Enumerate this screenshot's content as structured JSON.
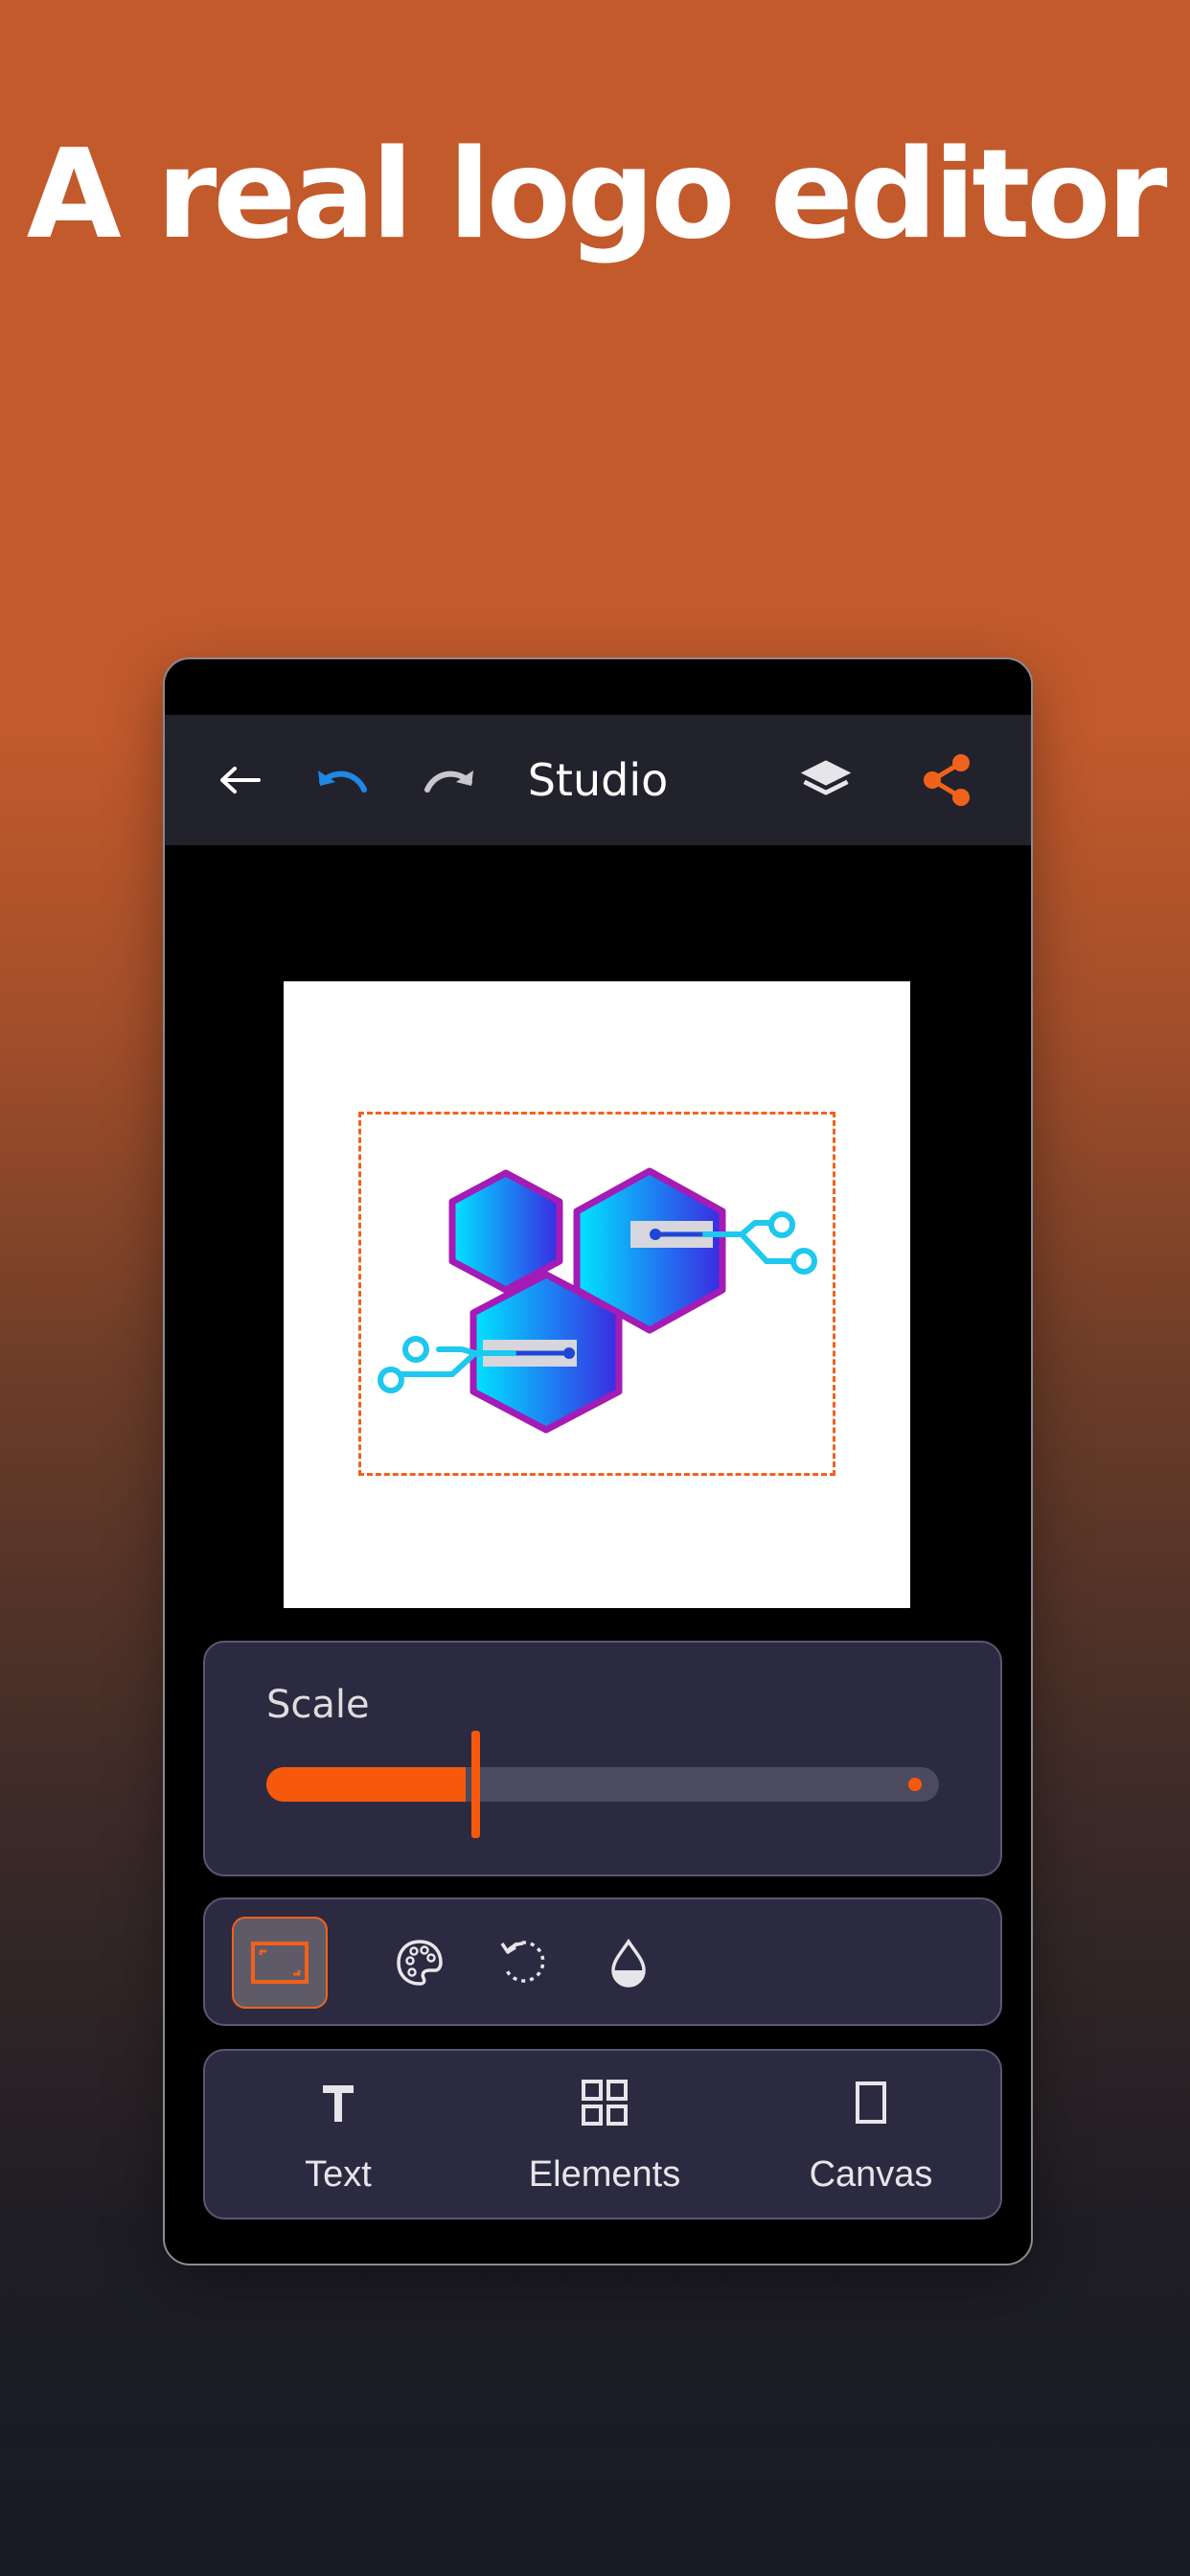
{
  "headline": "A real logo editor",
  "topbar": {
    "title": "Studio",
    "icons": [
      "back-arrow-icon",
      "undo-icon",
      "redo-icon",
      "layers-icon",
      "share-icon"
    ],
    "undo_color": "#1e88e5",
    "share_color": "#f0621c"
  },
  "scale": {
    "label": "Scale",
    "value_fraction": 0.31
  },
  "tools": [
    "resize-icon",
    "palette-icon",
    "rotate-icon",
    "opacity-icon"
  ],
  "nav": {
    "items": [
      {
        "label": "Text",
        "icon": "text-icon"
      },
      {
        "label": "Elements",
        "icon": "elements-grid-icon"
      },
      {
        "label": "Canvas",
        "icon": "canvas-rect-icon"
      }
    ]
  },
  "colors": {
    "accent": "#f7590c",
    "panel": "#2c2a40",
    "topbar": "#22222c"
  }
}
